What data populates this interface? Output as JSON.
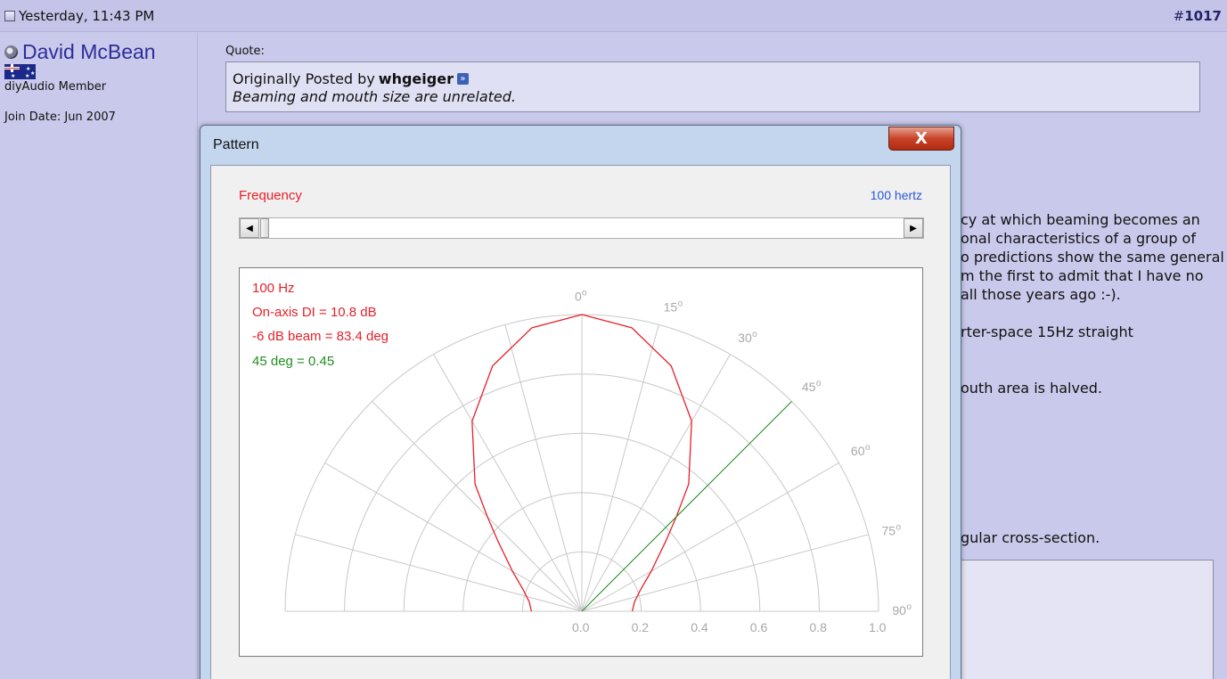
{
  "post": {
    "date": "Yesterday, 11:43 PM",
    "number_prefix": "#",
    "number": "1017"
  },
  "user": {
    "name": "David McBean",
    "title": "diyAudio Member",
    "join_date": "Join Date: Jun 2007"
  },
  "quote": {
    "label": "Quote:",
    "originally_posted_by": "Originally Posted by",
    "author": "whgeiger",
    "text": "Beaming and mouth size are unrelated."
  },
  "body_lines": [
    "cy at which beaming becomes an",
    "onal characteristics of a group of",
    "o predictions show the same general",
    "m the first to admit that I have no",
    "all those years ago :-).",
    "rter-space 15Hz straight",
    "outh area is halved.",
    "gular cross-section."
  ],
  "dialog": {
    "title": "Pattern",
    "close_label": "X",
    "frequency_label": "Frequency",
    "frequency_value": "100 hertz",
    "scroll_left": "◀",
    "scroll_right": "▶",
    "slider_position": 0.0,
    "info": {
      "freq": "100 Hz",
      "di": "On-axis DI = 10.8 dB",
      "beam": "-6 dB beam = 83.4 deg",
      "deg45": "45 deg = 0.45"
    },
    "colors": {
      "red": "#e8202a",
      "green": "#1f8f1f",
      "blue": "#2a56d8"
    }
  },
  "chart_data": {
    "type": "polar",
    "angle_labels": [
      "0",
      "15",
      "30",
      "45",
      "60",
      "75",
      "90"
    ],
    "angle_unit_symbol": "o",
    "radius_labels": [
      "0.0",
      "0.2",
      "0.4",
      "0.6",
      "0.8",
      "1.0"
    ],
    "rlim": [
      0,
      1.0
    ],
    "angle_range_deg": [
      0,
      90
    ],
    "grid": true,
    "series": [
      {
        "type": "polar-curve",
        "color": "#e8202a",
        "angle_deg": [
          0,
          10,
          20,
          30,
          40,
          45,
          50,
          60,
          70,
          80,
          90
        ],
        "r": [
          1.0,
          0.97,
          0.88,
          0.74,
          0.56,
          0.45,
          0.37,
          0.27,
          0.21,
          0.18,
          0.17
        ]
      },
      {
        "type": "radial-line",
        "color": "#1f8f1f",
        "angle_deg": 45,
        "r": 1.0
      }
    ]
  }
}
